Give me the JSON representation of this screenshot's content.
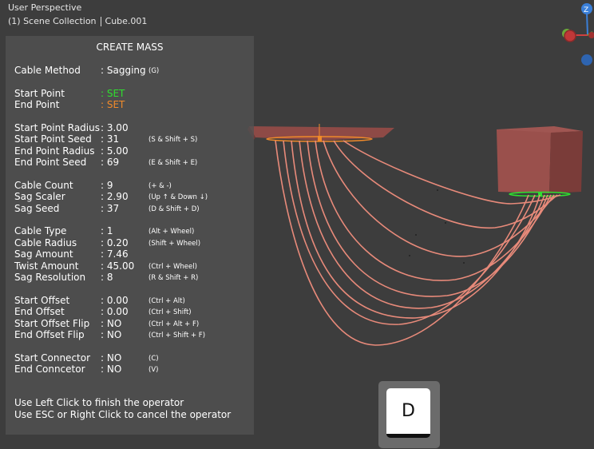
{
  "viewport": {
    "perspective": "User Perspective",
    "collection": "(1) Scene Collection",
    "object": "Cube.001"
  },
  "panel": {
    "title": "CREATE MASS",
    "rows": [
      {
        "label": "Cable Method",
        "value": ": Sagging",
        "key": "(G)"
      },
      {
        "label": "Start Point",
        "value": ": SET",
        "key": ""
      },
      {
        "label": "End Point",
        "value": ": SET",
        "key": ""
      },
      {
        "label": "Start Point Radius",
        "value": ": 3.00",
        "key": ""
      },
      {
        "label": "Start Point Seed",
        "value": ": 31",
        "key": "(S & Shift + S)"
      },
      {
        "label": "End Point Radius",
        "value": ": 5.00",
        "key": ""
      },
      {
        "label": "End Point Seed",
        "value": ": 69",
        "key": "(E & Shift + E)"
      },
      {
        "label": "Cable Count",
        "value": ": 9",
        "key": "(+ & -)"
      },
      {
        "label": "Sag Scaler",
        "value": ": 2.90",
        "key": "(Up ↑ & Down ↓)"
      },
      {
        "label": "Sag Seed",
        "value": ": 37",
        "key": "(D & Shift + D)"
      },
      {
        "label": "Cable Type",
        "value": ": 1",
        "key": "(Alt + Wheel)"
      },
      {
        "label": "Cable Radius",
        "value": ": 0.20",
        "key": "(Shift + Wheel)"
      },
      {
        "label": "Sag Amount",
        "value": ": 7.46",
        "key": ""
      },
      {
        "label": "Twist Amount",
        "value": ": 45.00",
        "key": "(Ctrl + Wheel)"
      },
      {
        "label": "Sag Resolution",
        "value": ": 8",
        "key": "(R & Shift + R)"
      },
      {
        "label": "Start Offset",
        "value": ": 0.00",
        "key": "(Ctrl + Alt)"
      },
      {
        "label": "End Offset",
        "value": ": 0.00",
        "key": "(Ctrl + Shift)"
      },
      {
        "label": "Start Offset Flip",
        "value": ": NO",
        "key": "(Ctrl + Alt + F)"
      },
      {
        "label": "End Offset Flip",
        "value": ": NO",
        "key": "(Ctrl + Shift + F)"
      },
      {
        "label": "Start Connector",
        "value": ": NO",
        "key": "(C)"
      },
      {
        "label": "End Conncetor",
        "value": ": NO",
        "key": "(V)"
      }
    ],
    "footer": [
      "Use Left Click to finish the operator",
      "Use ESC or Right Click to cancel the operator"
    ]
  },
  "gizmo": {
    "z_label": "Z"
  },
  "key_indicator": {
    "key": "D"
  },
  "colors": {
    "viewport_bg": "#3d3d3d",
    "set_start": "#2fe02f",
    "set_end": "#f08a2a",
    "cable": "#e88a7a",
    "object": "#9a4e4a"
  }
}
